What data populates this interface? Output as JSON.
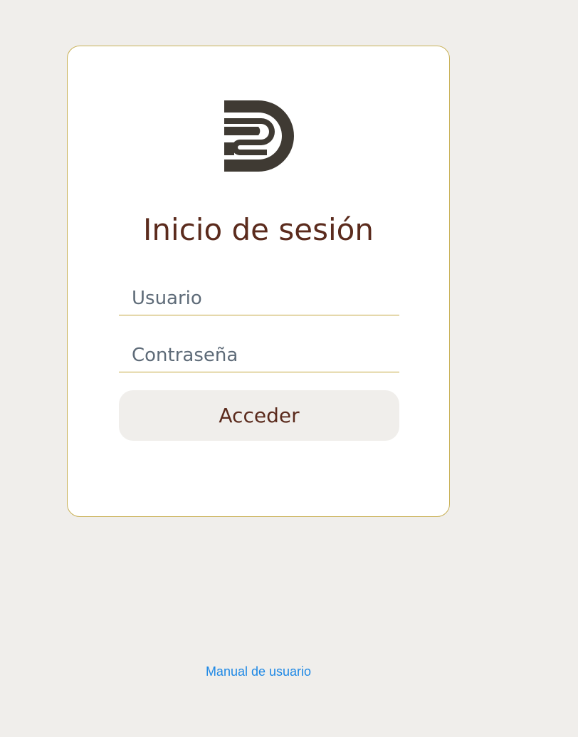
{
  "login": {
    "title": "Inicio de sesión",
    "username_placeholder": "Usuario",
    "username_value": "",
    "password_placeholder": "Contraseña",
    "password_value": "",
    "submit_label": "Acceder"
  },
  "footer": {
    "manual_link": "Manual de usuario"
  },
  "colors": {
    "page_background": "#f0eeeb",
    "card_border": "#c9b157",
    "title_text": "#5b2b1d",
    "input_underline": "#c3a53b",
    "link": "#1e88e5",
    "logo": "#3f3a33"
  },
  "logo": {
    "icon": "sd-monogram-logo"
  }
}
